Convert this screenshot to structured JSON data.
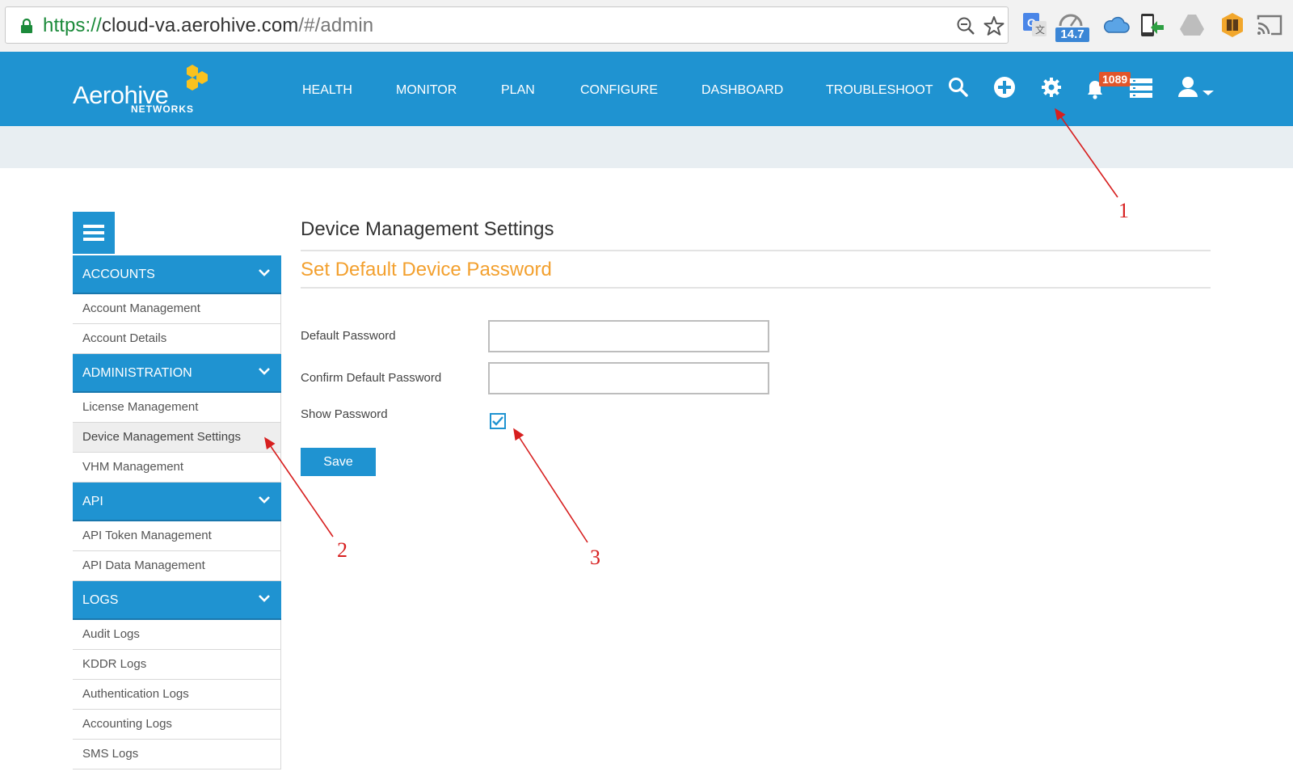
{
  "browser": {
    "url_scheme": "https://",
    "url_host": "cloud-va.aerohive.com",
    "url_path": "/#/admin",
    "extension_badge": "14.7"
  },
  "brand": {
    "name": "Aerohive",
    "sub": "NETWORKS"
  },
  "nav": {
    "items": [
      "HEALTH",
      "MONITOR",
      "PLAN",
      "CONFIGURE",
      "DASHBOARD",
      "TROUBLESHOOT"
    ],
    "notification_count": "1089"
  },
  "sidebar": {
    "sections": [
      {
        "title": "ACCOUNTS",
        "items": [
          "Account Management",
          "Account Details"
        ]
      },
      {
        "title": "ADMINISTRATION",
        "items": [
          "License Management",
          "Device Management Settings",
          "VHM Management"
        ]
      },
      {
        "title": "API",
        "items": [
          "API Token Management",
          "API Data Management"
        ]
      },
      {
        "title": "LOGS",
        "items": [
          "Audit Logs",
          "KDDR Logs",
          "Authentication Logs",
          "Accounting Logs",
          "SMS Logs"
        ]
      }
    ],
    "active_item": "Device Management Settings"
  },
  "main": {
    "title": "Device Management Settings",
    "section_title": "Set Default Device Password",
    "default_password_label": "Default Password",
    "default_password_value": "",
    "confirm_password_label": "Confirm Default Password",
    "confirm_password_value": "",
    "show_password_label": "Show Password",
    "show_password_checked": true,
    "save_label": "Save"
  },
  "annotations": [
    "1",
    "2",
    "3"
  ],
  "colors": {
    "brand_blue": "#1f93d1",
    "accent_orange": "#f3a02e",
    "annotation_red": "#d71f1f",
    "badge_red": "#e2552a"
  }
}
